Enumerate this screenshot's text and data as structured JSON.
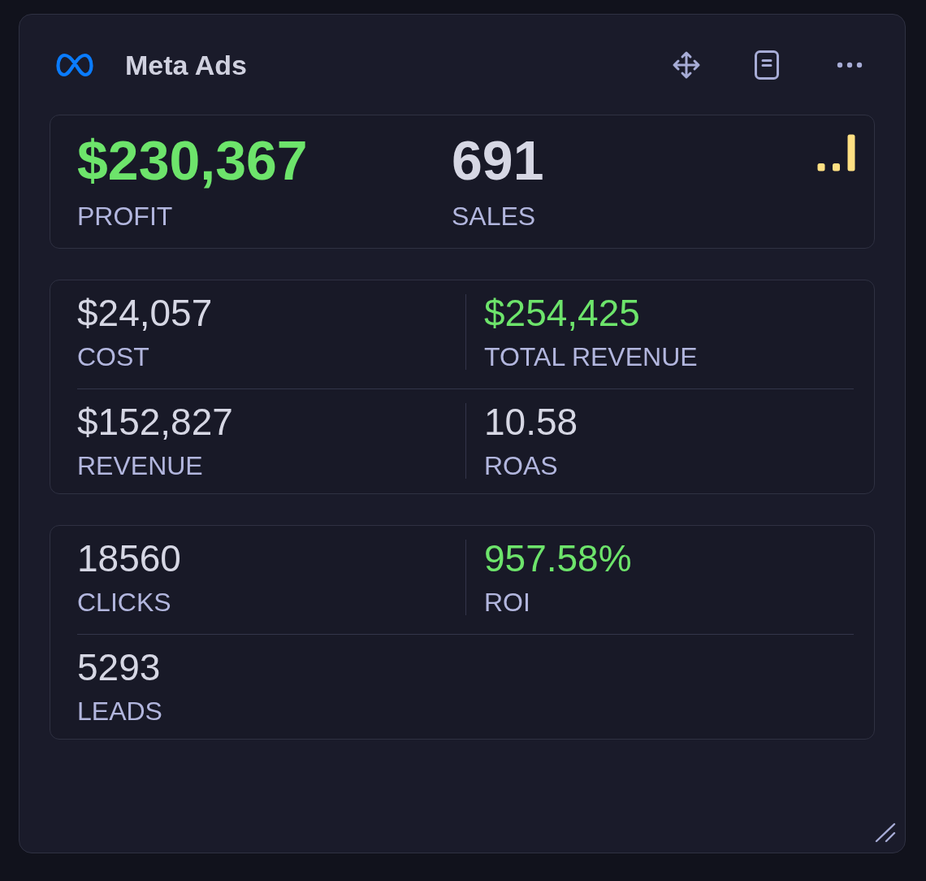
{
  "widget": {
    "title": "Meta Ads"
  },
  "summary": [
    {
      "value": "$230,367",
      "label": "PROFIT",
      "positive": true
    },
    {
      "value": "691",
      "label": "SALES",
      "positive": false
    }
  ],
  "sections": [
    {
      "rows": [
        {
          "cells": [
            {
              "value": "$24,057",
              "label": "COST",
              "positive": false
            },
            {
              "value": "$254,425",
              "label": "TOTAL REVENUE",
              "positive": true
            }
          ]
        },
        {
          "cells": [
            {
              "value": "$152,827",
              "label": "REVENUE",
              "positive": false
            },
            {
              "value": "10.58",
              "label": "ROAS",
              "positive": false
            }
          ]
        }
      ]
    },
    {
      "rows": [
        {
          "cells": [
            {
              "value": "18560",
              "label": "CLICKS",
              "positive": false
            },
            {
              "value": "957.58%",
              "label": "ROI",
              "positive": true
            }
          ]
        },
        {
          "cells": [
            {
              "value": "5293",
              "label": "LEADS",
              "positive": false
            }
          ]
        }
      ]
    }
  ]
}
